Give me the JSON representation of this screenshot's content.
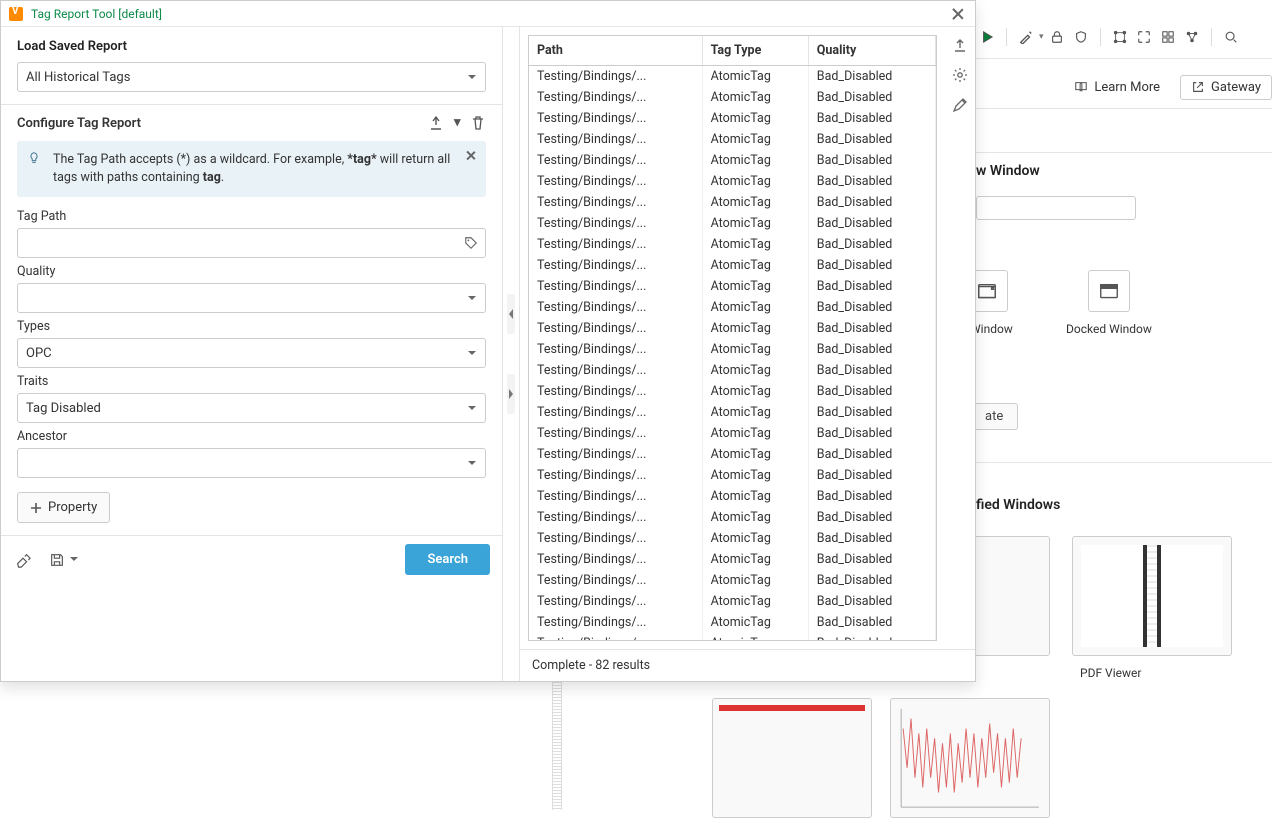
{
  "dialog": {
    "title": "Tag Report Tool [default]",
    "load_saved_label": "Load Saved Report",
    "load_saved_value": "All Historical Tags",
    "configure_label": "Configure Tag Report",
    "tip_text_1": "The Tag Path accepts (*) as a wildcard. For example, ",
    "tip_bold_1": "*tag*",
    "tip_text_2": " will return all tags with paths containing ",
    "tip_bold_2": "tag",
    "tip_text_3": ".",
    "fields": {
      "tag_path": {
        "label": "Tag Path",
        "value": ""
      },
      "quality": {
        "label": "Quality",
        "value": ""
      },
      "types": {
        "label": "Types",
        "value": "OPC"
      },
      "traits": {
        "label": "Traits",
        "value": "Tag Disabled"
      },
      "ancestor": {
        "label": "Ancestor",
        "value": ""
      }
    },
    "property_btn": "Property",
    "search_btn": "Search"
  },
  "results": {
    "columns": [
      "Path",
      "Tag Type",
      "Quality"
    ],
    "row": {
      "path": "Testing/Bindings/...",
      "type": "AtomicTag",
      "quality": "Bad_Disabled"
    },
    "row_count": 29,
    "status": "Complete - 82 results"
  },
  "background": {
    "learn_more": "Learn More",
    "gateway": "Gateway",
    "section1_title": "w Window",
    "window_label": "Window",
    "docked_label": "Docked Window",
    "ate_btn": "ate",
    "section2_title": "fied Windows",
    "thumb_pdf_label": "PDF Viewer"
  }
}
